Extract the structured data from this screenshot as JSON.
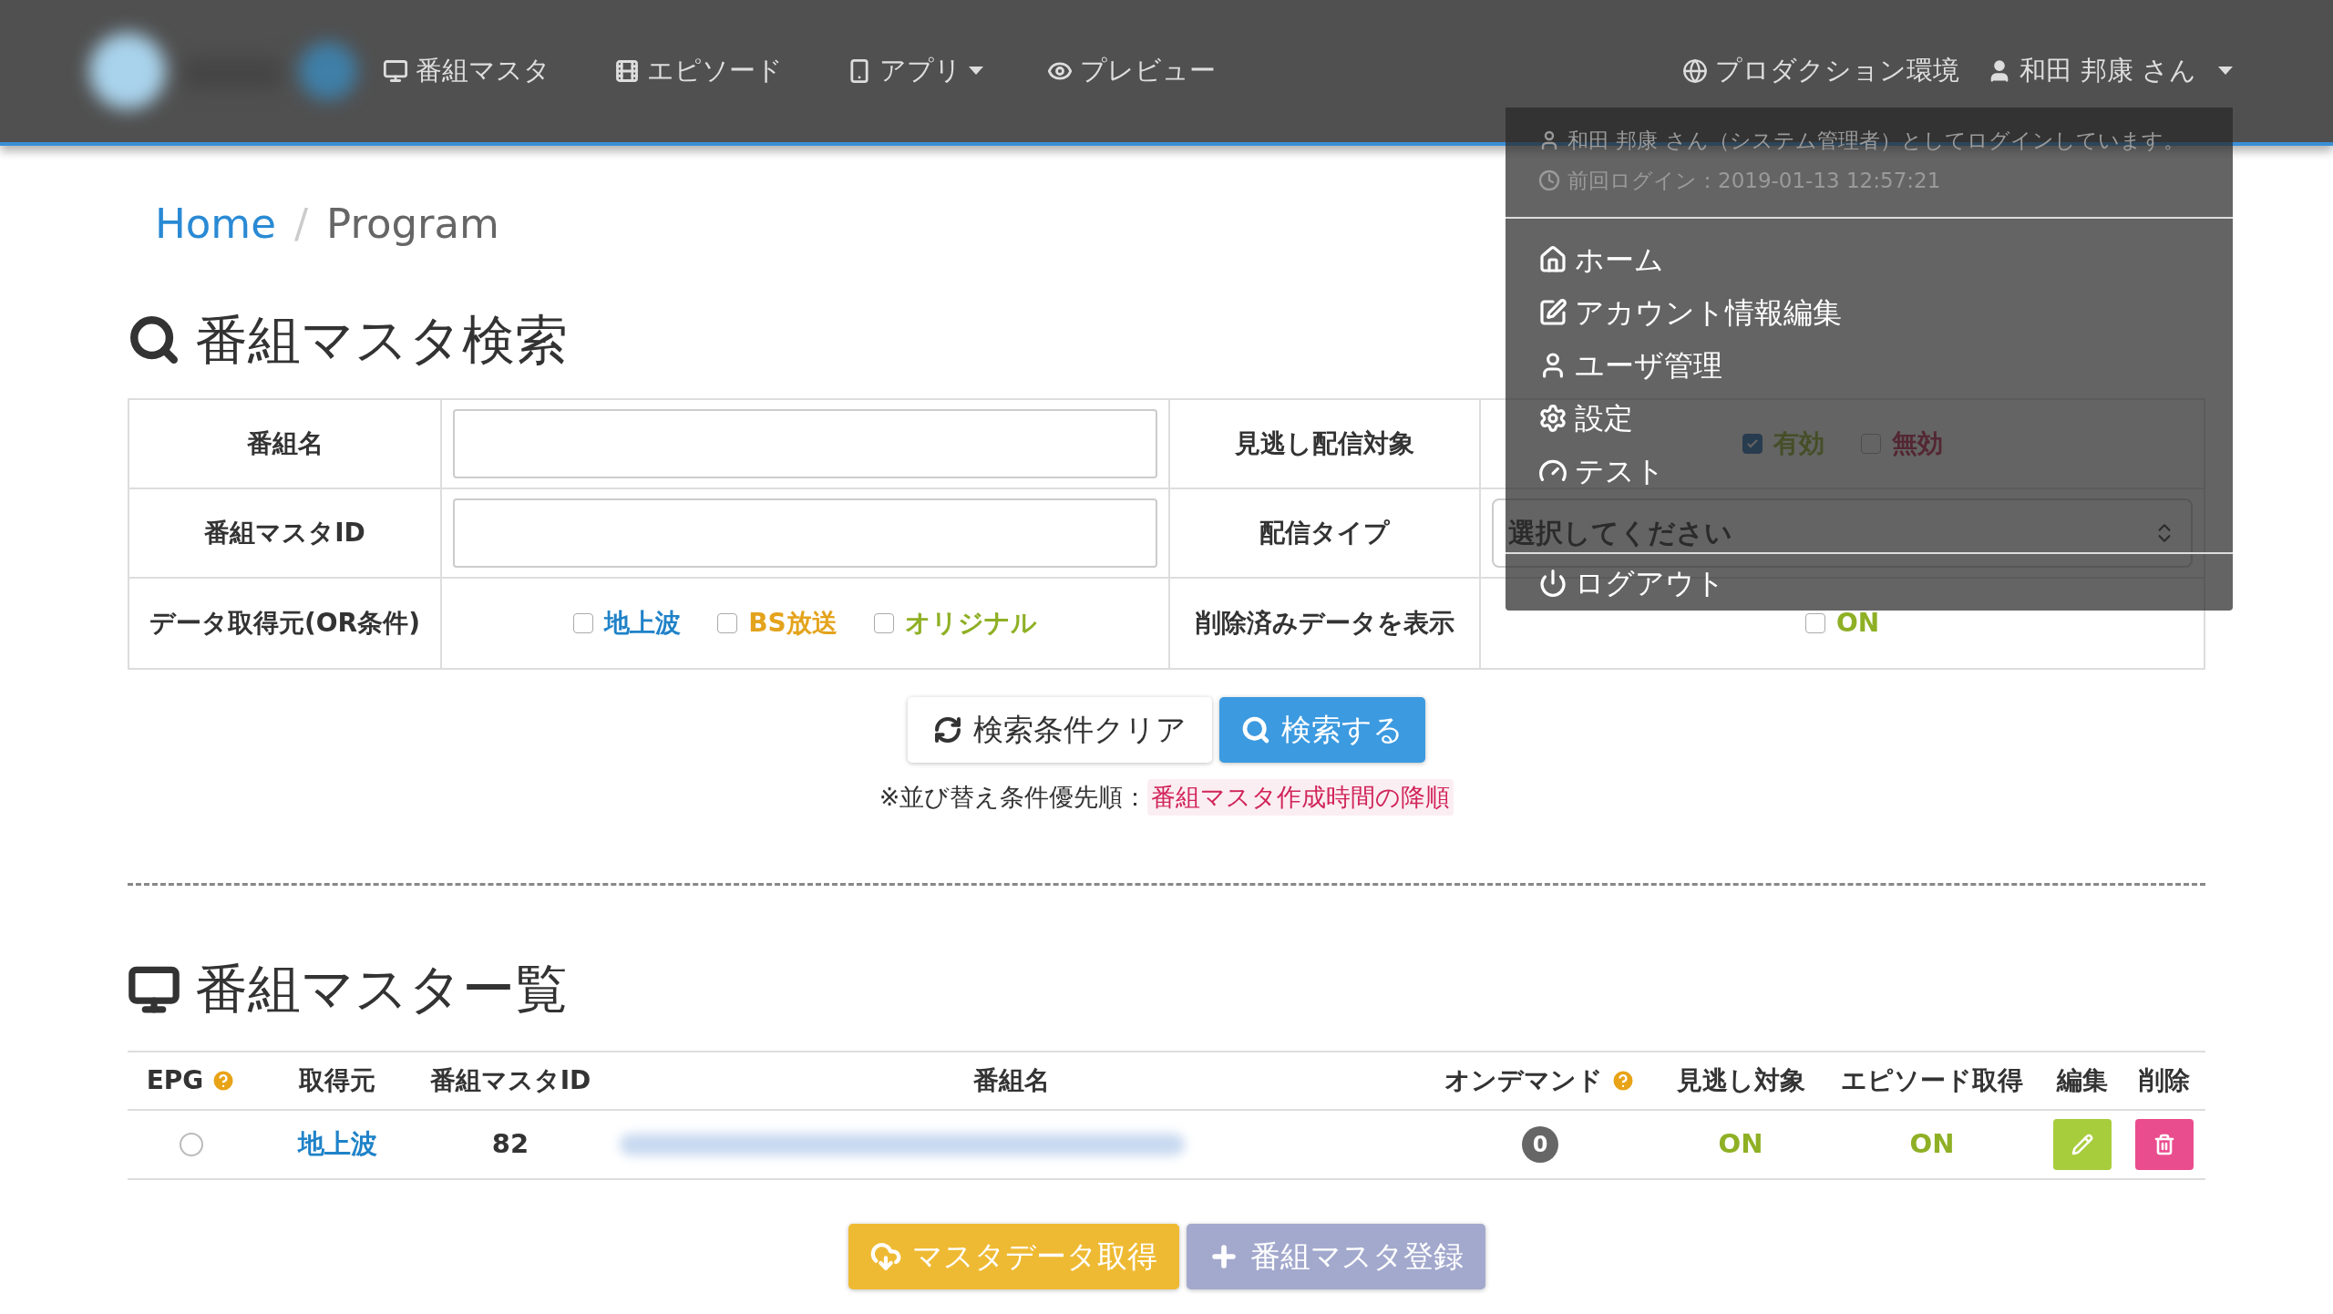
{
  "nav": {
    "items": [
      {
        "label": "番組マスタ",
        "caret": false
      },
      {
        "label": "エピソード",
        "caret": false
      },
      {
        "label": "アプリ",
        "caret": true
      },
      {
        "label": "プレビュー",
        "caret": false
      }
    ],
    "environment": "プロダクション環境",
    "user": "和田 邦康 さん"
  },
  "breadcrumb": [
    {
      "label": "Home",
      "link": true
    },
    {
      "label": "Program",
      "link": false
    }
  ],
  "breadcrumb_separator": "/",
  "search": {
    "title": "番組マスタ検索",
    "rows": [
      [
        {
          "label": "番組名",
          "kind": "text"
        },
        {
          "label": "見逃し配信対象",
          "kind": "checkboxes",
          "options": [
            {
              "label": "有効",
              "checked": true,
              "kind": "valid"
            },
            {
              "label": "無効",
              "checked": false,
              "kind": "invalid"
            }
          ]
        }
      ],
      [
        {
          "label": "番組マスタID",
          "kind": "text"
        },
        {
          "label": "配信タイプ",
          "kind": "select",
          "placeholder": "選択してください"
        }
      ],
      [
        {
          "label": "データ取得元(OR条件)",
          "kind": "checkboxes",
          "options": [
            {
              "label": "地上波",
              "checked": false,
              "color": "#1f82c8"
            },
            {
              "label": "BS放送",
              "checked": false,
              "color": "#e4a31c"
            },
            {
              "label": "オリジナル",
              "checked": false,
              "color": "#8fb025"
            }
          ]
        },
        {
          "label": "削除済みデータを表示",
          "kind": "checkboxes",
          "options": [
            {
              "label": "ON",
              "checked": false,
              "kind": "valid"
            }
          ]
        }
      ]
    ],
    "clear_button": "検索条件クリア",
    "search_button": "検索する",
    "sort_note": {
      "prefix": "※並び替え条件優先順：",
      "value": "番組マスタ作成時間の降順"
    }
  },
  "list": {
    "title": "番組マスター覧",
    "columns": [
      {
        "label": "EPG",
        "help": true
      },
      {
        "label": "取得元",
        "help": false
      },
      {
        "label": "番組マスタID",
        "help": false
      },
      {
        "label": "番組名",
        "help": false
      },
      {
        "label": "オンデマンド",
        "help": true
      },
      {
        "label": "見逃し対象",
        "help": false
      },
      {
        "label": "エピソード取得",
        "help": false
      },
      {
        "label": "編集",
        "help": false
      },
      {
        "label": "削除",
        "help": false
      }
    ],
    "rows": [
      {
        "epg_selected": false,
        "source": "地上波",
        "id": "82",
        "on_demand": "0",
        "missed": "ON",
        "episode": "ON"
      }
    ],
    "fetch_button": "マスタデータ取得",
    "register_button": "番組マスタ登録"
  },
  "user_menu": {
    "info": [
      "和田 邦康 さん（システム管理者）としてログインしています。",
      "前回ログイン：2019-01-13 12:57:21"
    ],
    "items": [
      "ホーム",
      "アカウント情報編集",
      "ユーザ管理",
      "設定",
      "テスト"
    ],
    "logout": "ログアウト"
  }
}
